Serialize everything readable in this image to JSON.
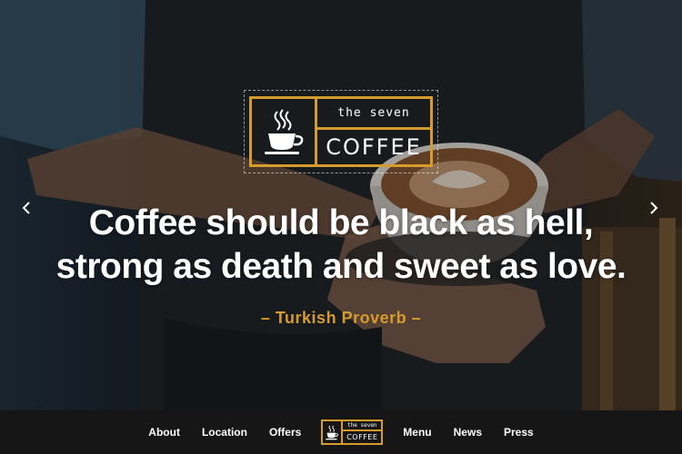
{
  "brand": {
    "top_text": "the seven",
    "bottom_text": "COFFEE",
    "accent_color": "#d59b2d",
    "icon": "coffee-cup-icon"
  },
  "hero": {
    "quote_line1": "Coffee should be black as hell,",
    "quote_line2": "strong as death and sweet as love.",
    "author": "– Turkish Proverb –",
    "prev_icon": "chevron-left-icon",
    "next_icon": "chevron-right-icon"
  },
  "nav": {
    "left_items": [
      {
        "label": "About"
      },
      {
        "label": "Location"
      },
      {
        "label": "Offers"
      }
    ],
    "right_items": [
      {
        "label": "Menu"
      },
      {
        "label": "News"
      },
      {
        "label": "Press"
      }
    ]
  }
}
